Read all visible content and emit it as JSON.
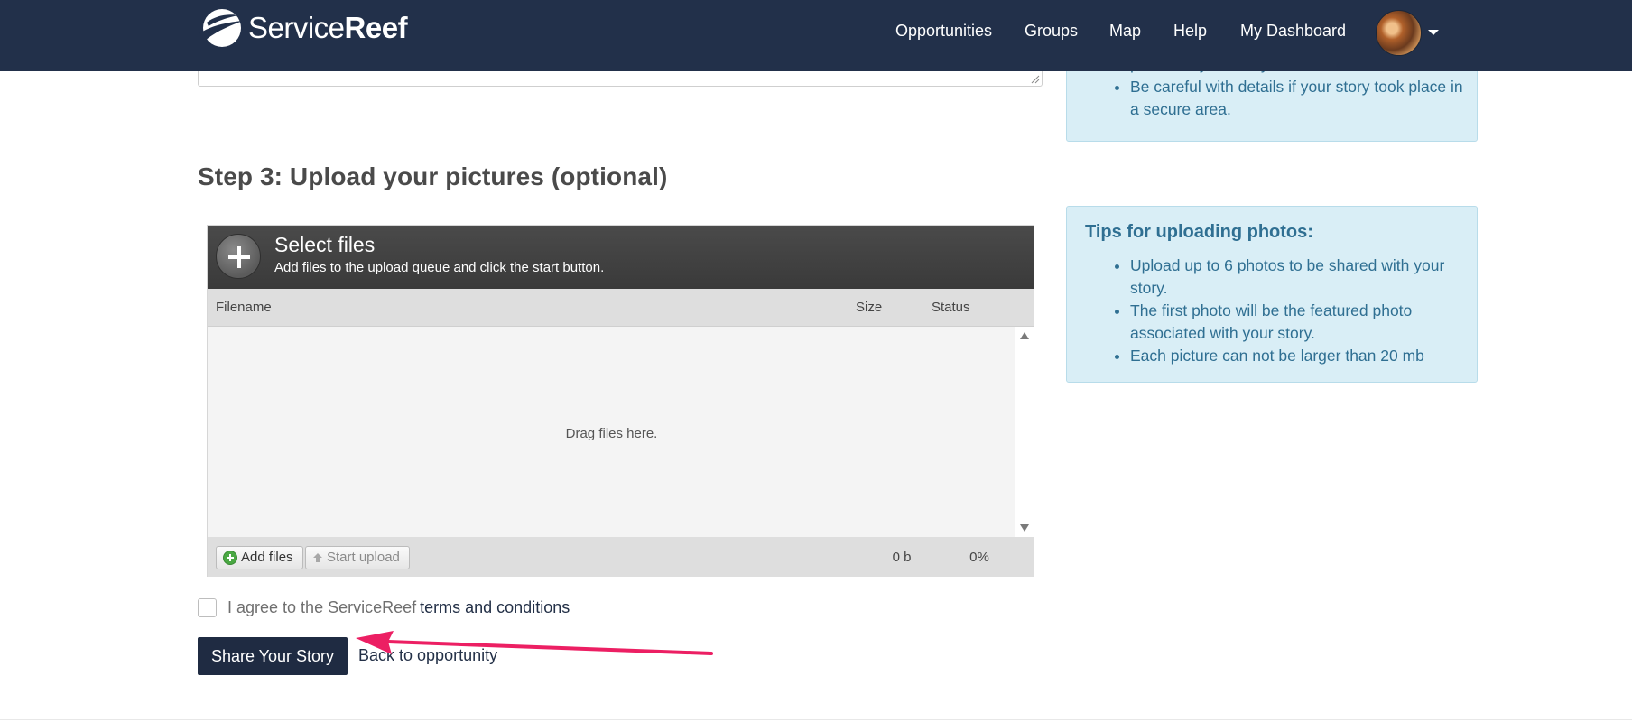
{
  "navbar": {
    "brand_light": "Service",
    "brand_bold": "Reef",
    "links": [
      "Opportunities",
      "Groups",
      "Map",
      "Help",
      "My Dashboard"
    ]
  },
  "top_info": {
    "items": [
      "picture of your story.",
      "Be careful with details if your story took place in a secure area."
    ]
  },
  "step3": {
    "title": "Step 3: Upload your pictures (optional)"
  },
  "uploader": {
    "title": "Select files",
    "subtitle": "Add files to the upload queue and click the start button.",
    "columns": {
      "filename": "Filename",
      "size": "Size",
      "status": "Status"
    },
    "drop_text": "Drag files here.",
    "add_files_label": "Add files",
    "start_upload_label": "Start upload",
    "total_size": "0 b",
    "total_percent": "0%"
  },
  "agree": {
    "prefix": "I agree to the ServiceReef",
    "link": "terms and conditions"
  },
  "actions": {
    "share_label": "Share Your Story",
    "back_label": "Back to opportunity"
  },
  "tips": {
    "title": "Tips for uploading photos:",
    "items": [
      "Upload up to 6 photos to be shared with your story.",
      "The first photo will be the featured photo associated with your story.",
      "Each picture can not be larger than 20 mb"
    ]
  },
  "colors": {
    "navbar_bg": "#22304a",
    "button_bg": "#1f2b42",
    "info_bg": "#d9eef6",
    "info_text": "#2f6f92",
    "arrow": "#ec1f63"
  },
  "icons": [
    "servicereef-logo-icon",
    "plus-icon",
    "scroll-up-icon",
    "scroll-down-icon",
    "add-green-icon",
    "upload-arrow-icon",
    "caret-down-icon",
    "resize-grip-icon",
    "annotation-arrow"
  ]
}
